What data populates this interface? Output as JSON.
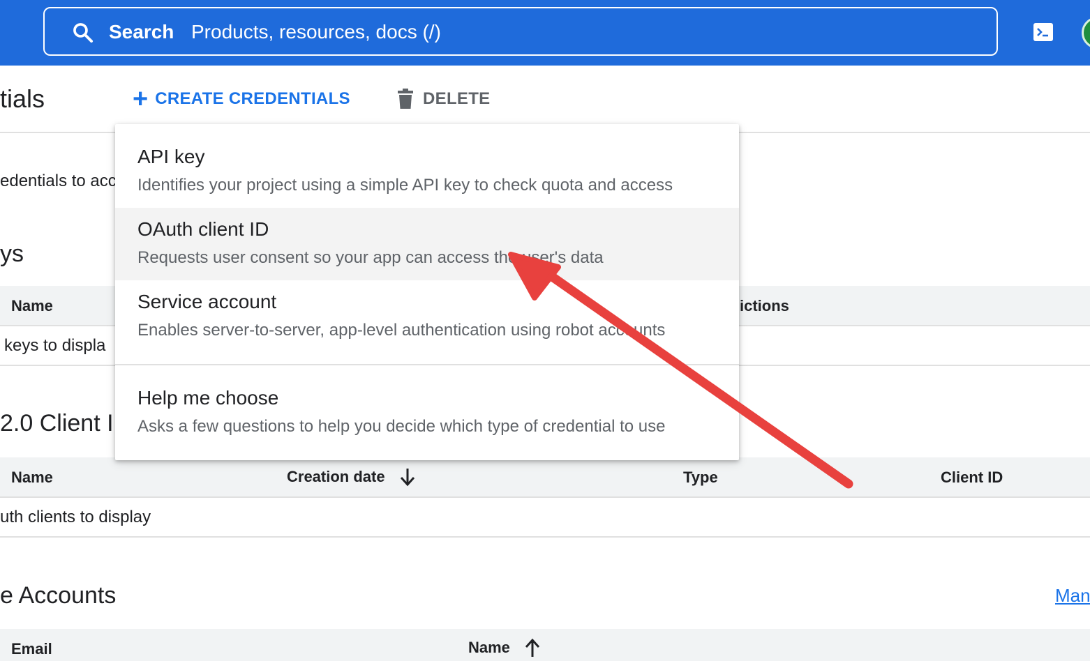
{
  "colors": {
    "topbar": "#1f6bdb",
    "accent": "#1a73e8",
    "annotation_arrow": "#e8413e"
  },
  "topbar": {
    "search_label": "Search",
    "search_placeholder": "Products, resources, docs (/)",
    "icons": [
      "search-icon",
      "cloud-shell-icon",
      "account-avatar"
    ]
  },
  "toolbar": {
    "title": "tials",
    "create_label": "CREATE CREDENTIALS",
    "delete_label": "DELETE"
  },
  "page": {
    "intro_text": "edentials to acc",
    "api_keys": {
      "heading": "ys",
      "columns": [
        "Name",
        "ictions"
      ],
      "empty": "keys to displa"
    },
    "oauth": {
      "heading": "2.0 Client I",
      "columns": [
        "Name",
        "Creation date",
        "Type",
        "Client ID"
      ],
      "empty": "uth clients to display"
    },
    "service_accounts": {
      "heading": "e Accounts",
      "manage_link": "Man",
      "columns": [
        "Email",
        "Name"
      ]
    }
  },
  "menu": {
    "items": [
      {
        "title": "API key",
        "desc": "Identifies your project using a simple API key to check quota and access"
      },
      {
        "title": "OAuth client ID",
        "desc": "Requests user consent so your app can access the user's data"
      },
      {
        "title": "Service account",
        "desc": "Enables server-to-server, app-level authentication using robot accounts"
      },
      {
        "title": "Help me choose",
        "desc": "Asks a few questions to help you decide which type of credential to use"
      }
    ]
  }
}
